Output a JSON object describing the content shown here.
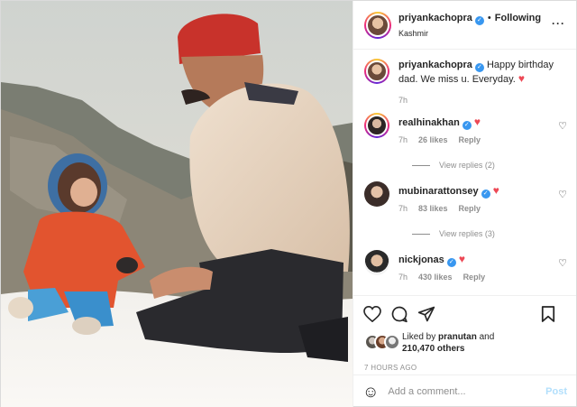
{
  "header": {
    "username": "priyankachopra",
    "verified_glyph": "✓",
    "separator": "•",
    "follow_status": "Following",
    "location": "Kashmir",
    "more_icon": "more-horizontal-icon"
  },
  "caption": {
    "username": "priyankachopra",
    "text": "Happy birthday dad. We miss u. Everyday.",
    "emoji": "♥",
    "time": "7h"
  },
  "comments": [
    {
      "username": "realhinakhan",
      "emoji": "♥",
      "time": "7h",
      "likes": "26 likes",
      "reply": "Reply",
      "view_replies": "View replies (2)"
    },
    {
      "username": "mubinarattonsey",
      "emoji": "♥",
      "time": "7h",
      "likes": "83 likes",
      "reply": "Reply",
      "view_replies": "View replies (3)"
    },
    {
      "username": "nickjonas",
      "emoji": "♥",
      "time": "7h",
      "likes": "430 likes",
      "reply": "Reply"
    }
  ],
  "actions": {
    "like_icon": "heart-outline-icon",
    "comment_icon": "comment-icon",
    "share_icon": "share-icon",
    "save_icon": "bookmark-icon"
  },
  "likes": {
    "prefix": "Liked by",
    "user": "pranutan",
    "joiner": "and",
    "count": "210,470 others"
  },
  "timestamp": "7 HOURS AGO",
  "add_comment": {
    "placeholder": "Add a comment...",
    "post_label": "Post",
    "emoji_icon": "smiley-icon"
  },
  "colors": {
    "verified": "#3897f0",
    "heart": "#ed4956",
    "post_button_disabled": "#b2dffc",
    "muted": "#8e8e8e"
  }
}
